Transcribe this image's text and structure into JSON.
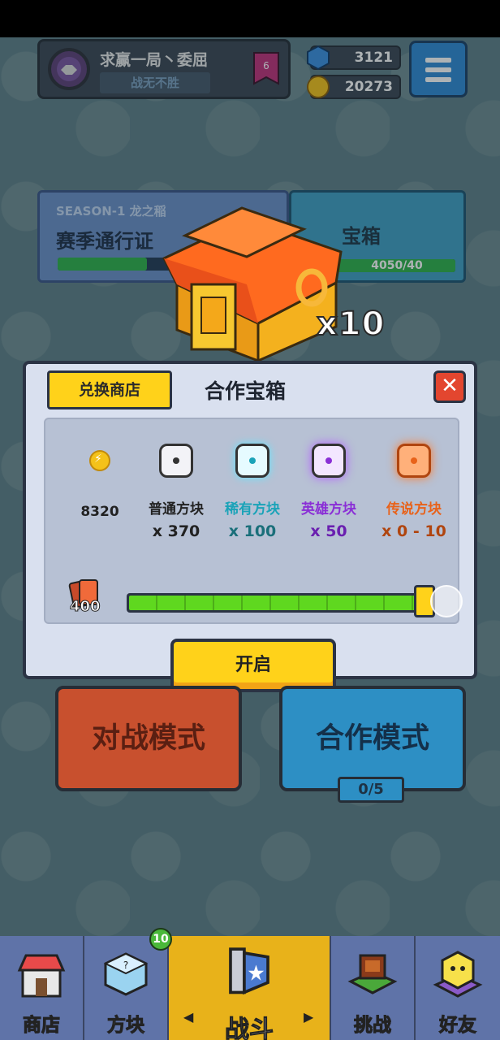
{
  "profile": {
    "name": "求赢一局丶委屈",
    "title": "战无不胜",
    "rank": "6"
  },
  "currency": {
    "gems": "3121",
    "coins": "20273"
  },
  "season": {
    "label": "SEASON-1 龙之稲",
    "name": "赛季通行证"
  },
  "chest_panel": {
    "title": "宝箱",
    "progress": "4050/40"
  },
  "reward": {
    "multiplier": "x10"
  },
  "dialog": {
    "shop_tab": "兑换商店",
    "title": "合作宝箱",
    "close": "✕",
    "items": [
      {
        "label": "8320",
        "qty": "",
        "icon": "coin-icon",
        "color": "#f4c21a"
      },
      {
        "label": "普通方块",
        "qty": "x 370",
        "icon": "common-cube-icon",
        "color": "#222222"
      },
      {
        "label": "稀有方块",
        "qty": "x 100",
        "icon": "rare-cube-icon",
        "color": "#1aa3b8"
      },
      {
        "label": "英雄方块",
        "qty": "x 50",
        "icon": "hero-cube-icon",
        "color": "#8a2fd6"
      },
      {
        "label": "传说方块",
        "qty": "x 0 - 10",
        "icon": "legend-cube-icon",
        "color": "#e8621a"
      }
    ],
    "card_count": "400",
    "slider_fraction": 1.0,
    "open_button": "开启"
  },
  "modes": {
    "pvp": "对战模式",
    "coop": "合作模式",
    "coop_count": "0/5"
  },
  "nav": {
    "items": [
      {
        "label": "商店",
        "icon": "shop-icon"
      },
      {
        "label": "方块",
        "icon": "dice-icon"
      },
      {
        "label": "战斗",
        "icon": "battle-icon"
      },
      {
        "label": "挑战",
        "icon": "challenge-icon"
      },
      {
        "label": "好友",
        "icon": "friends-icon"
      }
    ],
    "dice_badge": "10",
    "prev_arrow": "◀",
    "next_arrow": "▶"
  }
}
